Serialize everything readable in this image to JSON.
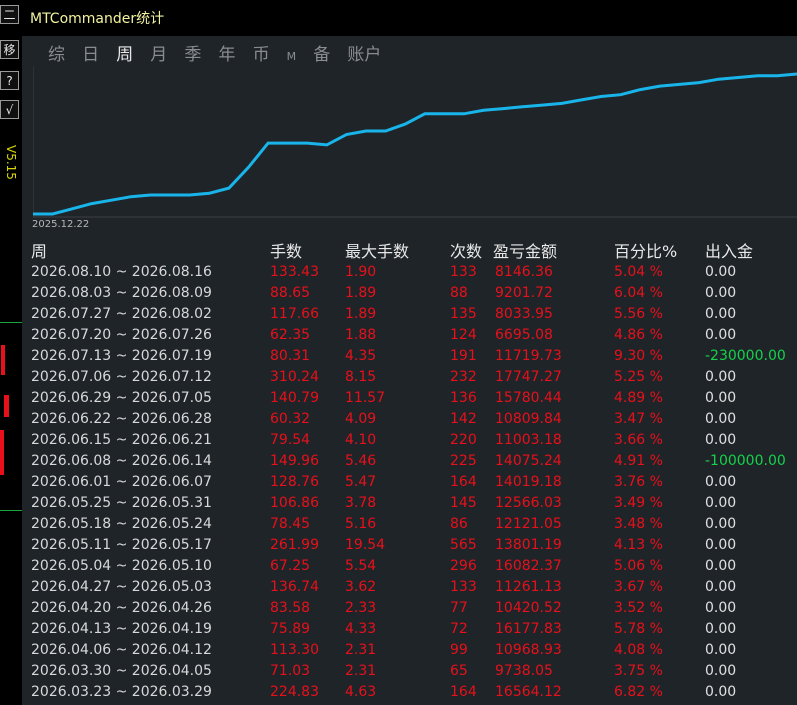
{
  "window": {
    "title": "MTCommander统计"
  },
  "left_toolbar": {
    "buttons": [
      "二",
      "移",
      "?",
      "√"
    ],
    "version": "V5.15"
  },
  "tabs": [
    "综",
    "日",
    "周",
    "月",
    "季",
    "年",
    "币",
    "M",
    "备",
    "账户"
  ],
  "active_tab": "周",
  "chart": {
    "start_date": "2025.12.22",
    "line_color": "#19b5ea"
  },
  "chart_data": {
    "type": "line",
    "x_start_label": "2025.12.22",
    "values": [
      0,
      0,
      3,
      6,
      8,
      10,
      11,
      11,
      11,
      12,
      15,
      27,
      41,
      41,
      41,
      40,
      46,
      48,
      48,
      52,
      58,
      58,
      58,
      60,
      61,
      62,
      63,
      64,
      66,
      68,
      69,
      72,
      74,
      75,
      76,
      78,
      79,
      80,
      80,
      81
    ]
  },
  "table": {
    "headers": [
      "周",
      "手数",
      "最大手数",
      "次数",
      "盈亏金额",
      "百分比%",
      "出入金"
    ],
    "rows": [
      {
        "week": "2026.08.10 ~ 2026.08.16",
        "lots": "133.43",
        "max_lots": "1.90",
        "count": "133",
        "pnl": "8146.36",
        "pct": "5.04 %",
        "inout": "0.00"
      },
      {
        "week": "2026.08.03 ~ 2026.08.09",
        "lots": "88.65",
        "max_lots": "1.89",
        "count": "88",
        "pnl": "9201.72",
        "pct": "6.04 %",
        "inout": "0.00"
      },
      {
        "week": "2026.07.27 ~ 2026.08.02",
        "lots": "117.66",
        "max_lots": "1.89",
        "count": "135",
        "pnl": "8033.95",
        "pct": "5.56 %",
        "inout": "0.00"
      },
      {
        "week": "2026.07.20 ~ 2026.07.26",
        "lots": "62.35",
        "max_lots": "1.88",
        "count": "124",
        "pnl": "6695.08",
        "pct": "4.86 %",
        "inout": "0.00"
      },
      {
        "week": "2026.07.13 ~ 2026.07.19",
        "lots": "80.31",
        "max_lots": "4.35",
        "count": "191",
        "pnl": "11719.73",
        "pct": "9.30 %",
        "inout": "-230000.00"
      },
      {
        "week": "2026.07.06 ~ 2026.07.12",
        "lots": "310.24",
        "max_lots": "8.15",
        "count": "232",
        "pnl": "17747.27",
        "pct": "5.25 %",
        "inout": "0.00"
      },
      {
        "week": "2026.06.29 ~ 2026.07.05",
        "lots": "140.79",
        "max_lots": "11.57",
        "count": "136",
        "pnl": "15780.44",
        "pct": "4.89 %",
        "inout": "0.00"
      },
      {
        "week": "2026.06.22 ~ 2026.06.28",
        "lots": "60.32",
        "max_lots": "4.09",
        "count": "142",
        "pnl": "10809.84",
        "pct": "3.47 %",
        "inout": "0.00"
      },
      {
        "week": "2026.06.15 ~ 2026.06.21",
        "lots": "79.54",
        "max_lots": "4.10",
        "count": "220",
        "pnl": "11003.18",
        "pct": "3.66 %",
        "inout": "0.00"
      },
      {
        "week": "2026.06.08 ~ 2026.06.14",
        "lots": "149.96",
        "max_lots": "5.46",
        "count": "225",
        "pnl": "14075.24",
        "pct": "4.91 %",
        "inout": "-100000.00"
      },
      {
        "week": "2026.06.01 ~ 2026.06.07",
        "lots": "128.76",
        "max_lots": "5.47",
        "count": "164",
        "pnl": "14019.18",
        "pct": "3.76 %",
        "inout": "0.00"
      },
      {
        "week": "2026.05.25 ~ 2026.05.31",
        "lots": "106.86",
        "max_lots": "3.78",
        "count": "145",
        "pnl": "12566.03",
        "pct": "3.49 %",
        "inout": "0.00"
      },
      {
        "week": "2026.05.18 ~ 2026.05.24",
        "lots": "78.45",
        "max_lots": "5.16",
        "count": "86",
        "pnl": "12121.05",
        "pct": "3.48 %",
        "inout": "0.00"
      },
      {
        "week": "2026.05.11 ~ 2026.05.17",
        "lots": "261.99",
        "max_lots": "19.54",
        "count": "565",
        "pnl": "13801.19",
        "pct": "4.13 %",
        "inout": "0.00"
      },
      {
        "week": "2026.05.04 ~ 2026.05.10",
        "lots": "67.25",
        "max_lots": "5.54",
        "count": "296",
        "pnl": "16082.37",
        "pct": "5.06 %",
        "inout": "0.00"
      },
      {
        "week": "2026.04.27 ~ 2026.05.03",
        "lots": "136.74",
        "max_lots": "3.62",
        "count": "133",
        "pnl": "11261.13",
        "pct": "3.67 %",
        "inout": "0.00"
      },
      {
        "week": "2026.04.20 ~ 2026.04.26",
        "lots": "83.58",
        "max_lots": "2.33",
        "count": "77",
        "pnl": "10420.52",
        "pct": "3.52 %",
        "inout": "0.00"
      },
      {
        "week": "2026.04.13 ~ 2026.04.19",
        "lots": "75.89",
        "max_lots": "4.33",
        "count": "72",
        "pnl": "16177.83",
        "pct": "5.78 %",
        "inout": "0.00"
      },
      {
        "week": "2026.04.06 ~ 2026.04.12",
        "lots": "113.30",
        "max_lots": "2.31",
        "count": "99",
        "pnl": "10968.93",
        "pct": "4.08 %",
        "inout": "0.00"
      },
      {
        "week": "2026.03.30 ~ 2026.04.05",
        "lots": "71.03",
        "max_lots": "2.31",
        "count": "65",
        "pnl": "9738.05",
        "pct": "3.75 %",
        "inout": "0.00"
      },
      {
        "week": "2026.03.23 ~ 2026.03.29",
        "lots": "224.83",
        "max_lots": "4.63",
        "count": "164",
        "pnl": "16564.12",
        "pct": "6.82 %",
        "inout": "0.00"
      }
    ]
  }
}
